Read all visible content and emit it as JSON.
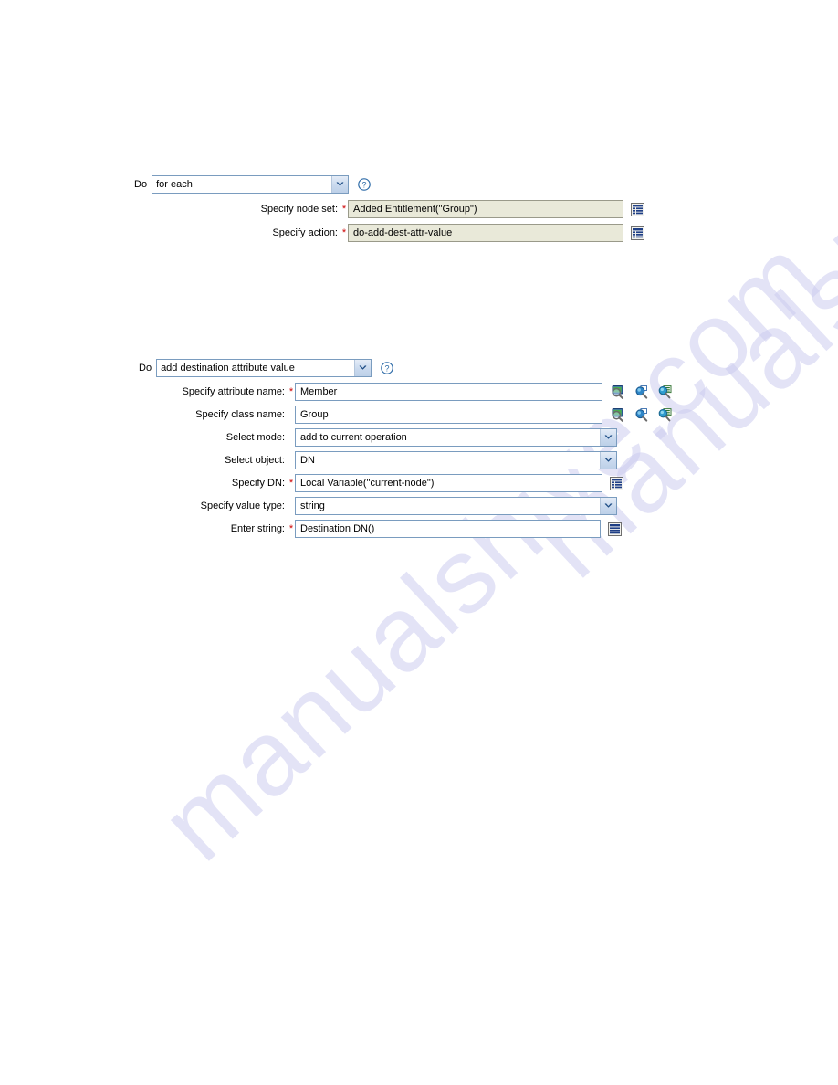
{
  "watermark": {
    "text": "manualshive.com"
  },
  "colors": {
    "field_border": "#7a9cbf",
    "readonly_bg": "#e9e9d9",
    "readonly_border": "#9a9a8a",
    "required_asterisk": "#cc0000",
    "combo_button": "#c9d9ee",
    "help_blue": "#2f6ca8",
    "watermark": "#cdcdf0"
  },
  "panels": [
    {
      "id": "for-each",
      "do_label": "Do",
      "action": {
        "value": "for each",
        "help_icon": "help-circle-icon",
        "dropdown_icon": "chevron-down-icon"
      },
      "fields": [
        {
          "label": "Specify node set:",
          "required": true,
          "value": "Added Entitlement(\"Group\")",
          "control": "text",
          "readonly": true,
          "buttons": [
            "argument-builder-icon"
          ]
        },
        {
          "label": "Specify action:",
          "required": true,
          "value": "do-add-dest-attr-value",
          "control": "text",
          "readonly": true,
          "buttons": [
            "argument-builder-icon"
          ]
        }
      ]
    },
    {
      "id": "add-destination-attribute-value",
      "do_label": "Do",
      "action": {
        "value": "add destination attribute value",
        "help_icon": "help-circle-icon",
        "dropdown_icon": "chevron-down-icon"
      },
      "fields": [
        {
          "label": "Specify attribute name:",
          "required": true,
          "value": "Member",
          "control": "text",
          "readonly": false,
          "buttons": [
            "browse-attributes-icon",
            "search-icon",
            "list-search-icon"
          ]
        },
        {
          "label": "Specify class name:",
          "required": false,
          "value": "Group",
          "control": "text",
          "readonly": false,
          "buttons": [
            "browse-attributes-icon",
            "search-icon",
            "list-search-icon"
          ]
        },
        {
          "label": "Select mode:",
          "required": false,
          "value": "add to current operation",
          "control": "select",
          "readonly": false,
          "buttons": []
        },
        {
          "label": "Select object:",
          "required": false,
          "value": "DN",
          "control": "select",
          "readonly": false,
          "buttons": []
        },
        {
          "label": "Specify DN:",
          "required": true,
          "value": "Local Variable(\"current-node\")",
          "control": "text",
          "readonly": false,
          "buttons": [
            "argument-builder-icon"
          ]
        },
        {
          "label": "Specify value type:",
          "required": false,
          "value": "string",
          "control": "select",
          "readonly": false,
          "buttons": []
        },
        {
          "label": "Enter string:",
          "required": true,
          "value": "Destination DN()",
          "control": "text",
          "readonly": false,
          "buttons": [
            "argument-builder-icon"
          ]
        }
      ]
    }
  ]
}
